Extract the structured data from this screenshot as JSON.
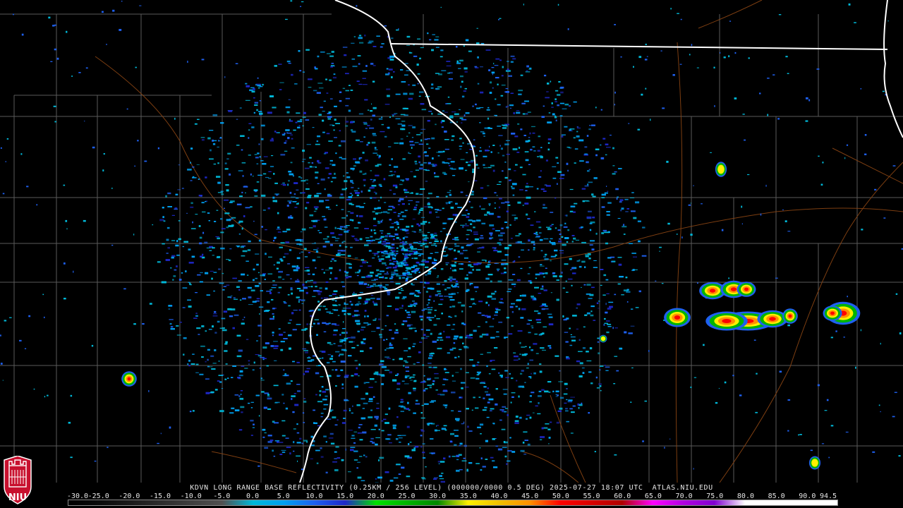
{
  "caption": "KDVN LONG RANGE BASE REFLECTIVITY (0.25KM / 256 LEVEL) (000000/0000 0.5 DEG) 2025-07-27 18:07 UTC  ATLAS.NIU.EDU",
  "scale": {
    "labels": [
      "-30.0",
      "-25.0",
      "-20.0",
      "-15.0",
      "-10.0",
      "-5.0",
      "0.0",
      "5.0",
      "10.0",
      "15.0",
      "20.0",
      "25.0",
      "30.0",
      "35.0",
      "40.0",
      "45.0",
      "50.0",
      "55.0",
      "60.0",
      "65.0",
      "70.0",
      "75.0",
      "80.0",
      "85.0",
      "90.0",
      "94.5"
    ],
    "colors": [
      "#000000",
      "#0a0a0a",
      "#1a1a1a",
      "#2c2c2c",
      "#3e3e3e",
      "#505050",
      "#00b8d8",
      "#00a0f0",
      "#1e60f0",
      "#1e28c8",
      "#00e000",
      "#00b400",
      "#008800",
      "#fff000",
      "#f0c000",
      "#ff9000",
      "#ff0000",
      "#d80000",
      "#b00000",
      "#ff00ff",
      "#b000e0",
      "#8000d0",
      "#ffffff",
      "#ffffff",
      "#ffffff",
      "#ffffff"
    ]
  },
  "logo": {
    "text": "NIU",
    "bg": "#c8102e"
  },
  "colors": {
    "background": "#000000",
    "county_lines": "#5a5a5a",
    "state_lines": "#ffffff",
    "roads": "#8b4513"
  },
  "radar_site": "KDVN",
  "radar_site_icon": "radar-site-dot"
}
